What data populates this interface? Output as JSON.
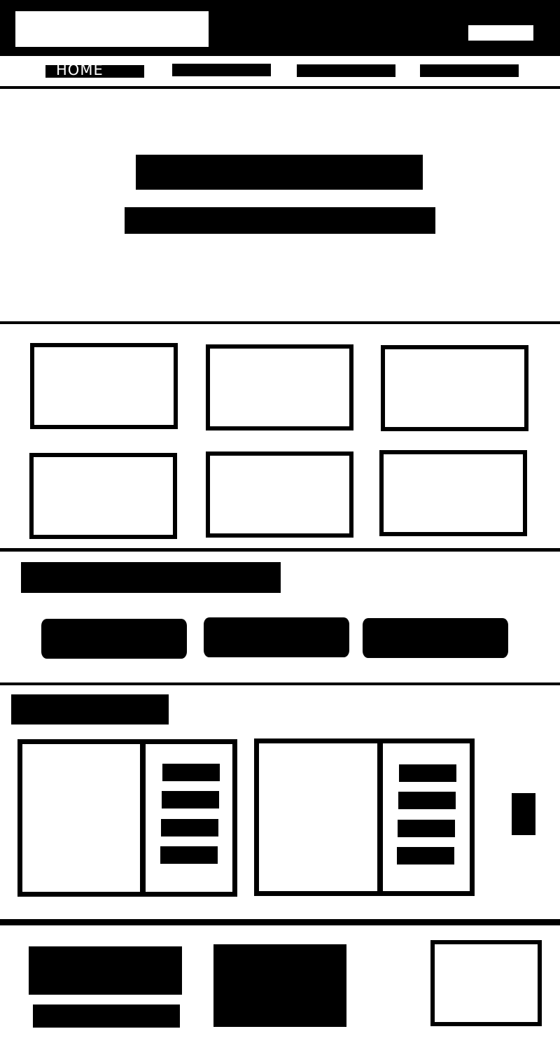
{
  "nav": {
    "home_label": "HOME"
  },
  "colors": {
    "ink": "#000000",
    "paper": "#ffffff"
  }
}
